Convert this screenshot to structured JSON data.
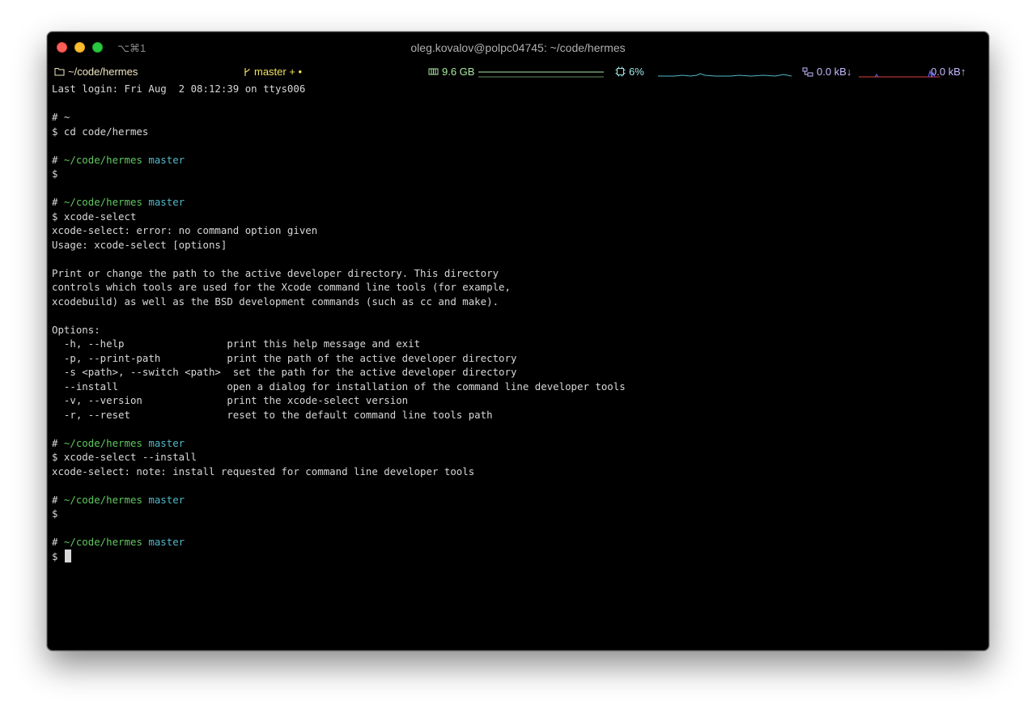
{
  "window": {
    "title": "oleg.kovalov@polpc04745: ~/code/hermes",
    "shortcut": "⌥⌘1"
  },
  "status": {
    "dir": "~/code/hermes",
    "branch": "master + •",
    "mem": "9.6 GB",
    "cpu": "6%",
    "net_down": "0.0 kB↓",
    "net_up": "0.0 kB↑"
  },
  "colors": {
    "prompt_path": "#5fc85f",
    "prompt_branch": "#4fb8c8",
    "text": "#d8d8d8",
    "background": "#000000"
  },
  "terminal": {
    "last_login": "Last login: Fri Aug  2 08:12:39 on ttys006",
    "p1_hash": "# ~",
    "p1_cmd": "$ cd code/hermes",
    "prompt_path": "~/code/hermes",
    "prompt_branch": "master",
    "p2_cmd": "$",
    "p3_cmd": "$ xcode-select",
    "err_line": "xcode-select: error: no command option given",
    "usage_line": "Usage: xcode-select [options]",
    "desc_1": "Print or change the path to the active developer directory. This directory",
    "desc_2": "controls which tools are used for the Xcode command line tools (for example,",
    "desc_3": "xcodebuild) as well as the BSD development commands (such as cc and make).",
    "options_header": "Options:",
    "options": [
      "  -h, --help                 print this help message and exit",
      "  -p, --print-path           print the path of the active developer directory",
      "  -s <path>, --switch <path>  set the path for the active developer directory",
      "  --install                  open a dialog for installation of the command line developer tools",
      "  -v, --version              print the xcode-select version",
      "  -r, --reset                reset to the default command line tools path"
    ],
    "p4_cmd": "$ xcode-select --install",
    "note_line": "xcode-select: note: install requested for command line developer tools",
    "p5_cmd": "$",
    "p6_cmd": "$"
  }
}
